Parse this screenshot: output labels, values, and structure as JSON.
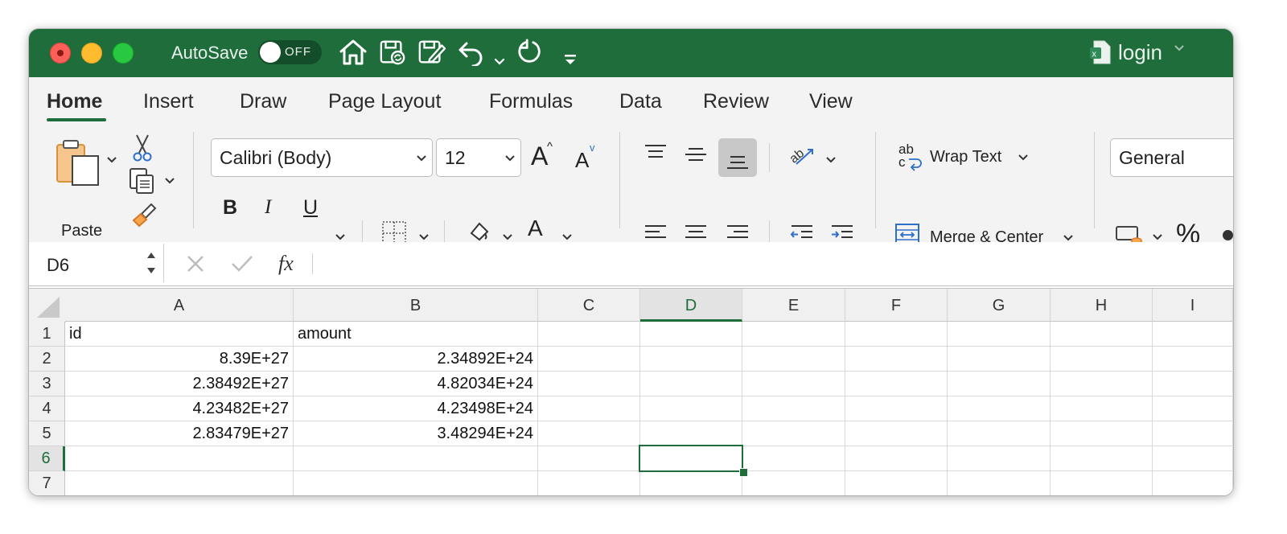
{
  "titlebar": {
    "autosave_label": "AutoSave",
    "autosave_state": "OFF",
    "doc_title": "login",
    "icons": [
      "home-icon",
      "save-sync-icon",
      "edit-doc-icon",
      "undo-icon",
      "chevron-down-icon",
      "redo-icon",
      "customize-toolbar-icon",
      "excel-file-icon"
    ]
  },
  "tabs": [
    "Home",
    "Insert",
    "Draw",
    "Page Layout",
    "Formulas",
    "Data",
    "Review",
    "View"
  ],
  "active_tab": "Home",
  "ribbon": {
    "paste_label": "Paste",
    "font_name": "Calibri (Body)",
    "font_size": "12",
    "bold": "B",
    "italic": "I",
    "underline": "U",
    "font_color_glyph": "A",
    "grow_font": "A",
    "shrink_font": "A",
    "wrap_icon": "ab",
    "wrap_icon_c": "c",
    "wrap_text_label": "Wrap Text",
    "merge_center_label": "Merge & Center",
    "number_format": "General",
    "percent": "%"
  },
  "formula_bar": {
    "name_box": "D6",
    "fx": "fx",
    "formula": ""
  },
  "sheet": {
    "columns": [
      "A",
      "B",
      "C",
      "D",
      "E",
      "F",
      "G",
      "H",
      "I"
    ],
    "selected_column": "D",
    "rows": [
      "1",
      "2",
      "3",
      "4",
      "5",
      "6",
      "7"
    ],
    "selected_row": "6",
    "cells": [
      [
        "id",
        "amount"
      ],
      [
        "8.39E+27",
        "2.34892E+24"
      ],
      [
        "2.38492E+27",
        "4.82034E+24"
      ],
      [
        "4.23482E+27",
        "4.23498E+24"
      ],
      [
        "2.83479E+27",
        "3.48294E+24"
      ],
      [
        "",
        ""
      ],
      [
        "",
        ""
      ]
    ]
  },
  "colors": {
    "excel_green": "#1f6d3b",
    "highlight_yellow": "#ffee00",
    "font_red": "#e8262a"
  }
}
